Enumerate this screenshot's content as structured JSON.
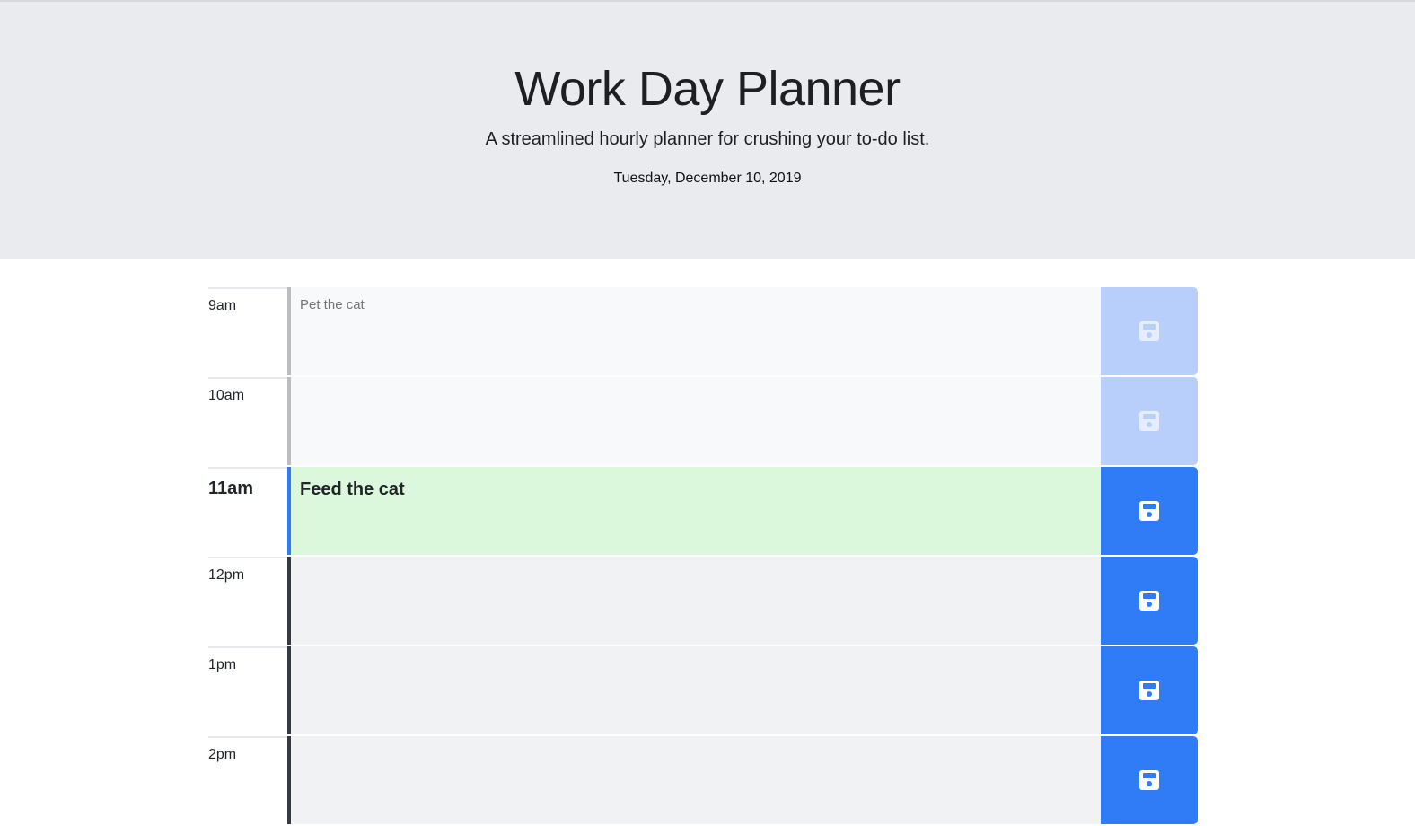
{
  "header": {
    "title": "Work Day Planner",
    "subtitle": "A streamlined hourly planner for crushing your to-do list.",
    "date": "Tuesday, December 10, 2019"
  },
  "colors": {
    "past": "#f8f9fb",
    "present": "#dbf7dc",
    "future": "#f1f2f4",
    "save_active": "#2f7cf6",
    "save_dim": "#b8cffb"
  },
  "rows": [
    {
      "hour": "9am",
      "state": "past",
      "text": "",
      "placeholder": "Pet the cat",
      "save_icon": "floppy-disk-icon"
    },
    {
      "hour": "10am",
      "state": "past",
      "text": "",
      "placeholder": "",
      "save_icon": "floppy-disk-icon"
    },
    {
      "hour": "11am",
      "state": "present",
      "text": "Feed the cat",
      "placeholder": "",
      "save_icon": "floppy-disk-icon"
    },
    {
      "hour": "12pm",
      "state": "future",
      "text": "",
      "placeholder": "",
      "save_icon": "floppy-disk-icon"
    },
    {
      "hour": "1pm",
      "state": "future",
      "text": "",
      "placeholder": "",
      "save_icon": "floppy-disk-icon"
    },
    {
      "hour": "2pm",
      "state": "future",
      "text": "",
      "placeholder": "",
      "save_icon": "floppy-disk-icon"
    }
  ]
}
